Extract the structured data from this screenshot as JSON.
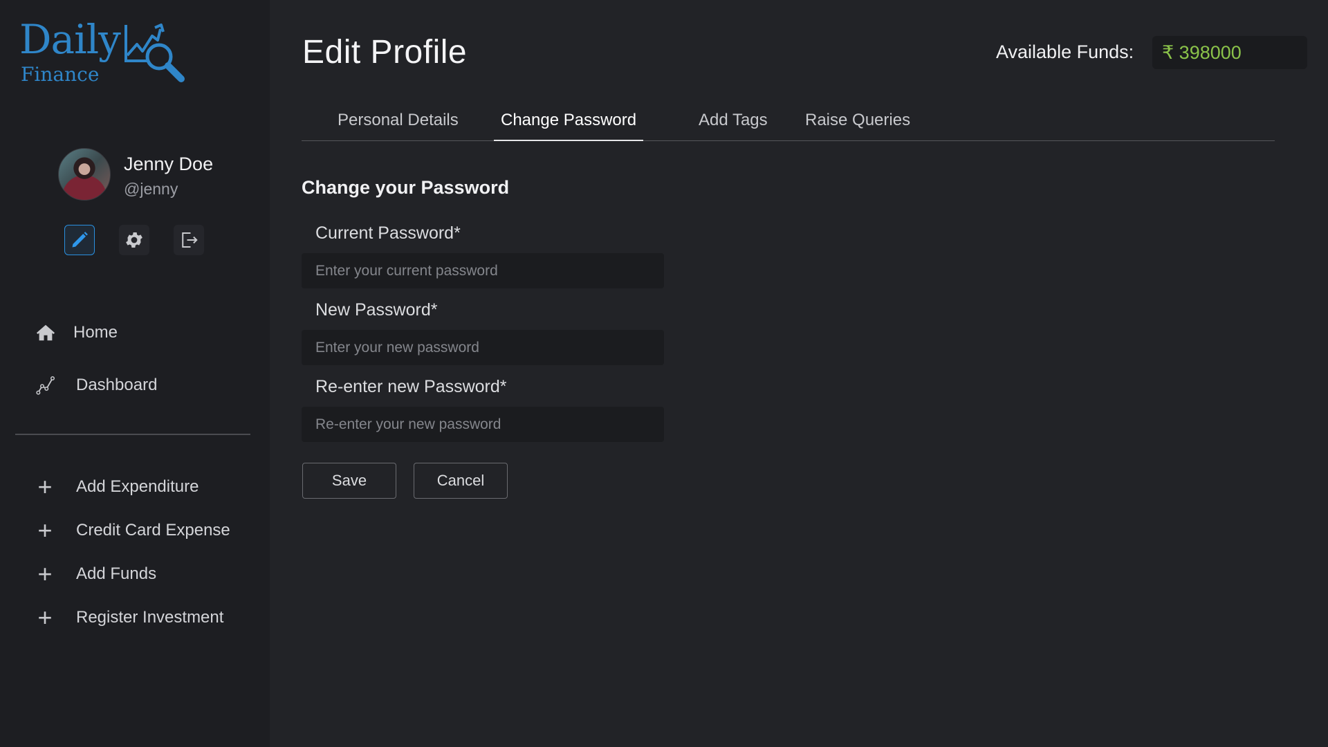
{
  "brand": {
    "name_top": "Daily",
    "name_bottom": "Finance",
    "color": "#2f86c9"
  },
  "user": {
    "name": "Jenny Doe",
    "handle": "@jenny"
  },
  "profile_actions": [
    {
      "name": "edit",
      "icon": "pencil-icon",
      "active": true
    },
    {
      "name": "settings",
      "icon": "gear-icon",
      "active": false
    },
    {
      "name": "logout",
      "icon": "logout-icon",
      "active": false
    }
  ],
  "sidebar": {
    "nav": [
      {
        "label": "Home",
        "icon": "home-icon"
      },
      {
        "label": "Dashboard",
        "icon": "chart-icon"
      }
    ],
    "actions": [
      {
        "label": "Add Expenditure",
        "icon": "plus-icon"
      },
      {
        "label": "Credit Card Expense",
        "icon": "plus-icon"
      },
      {
        "label": "Add Funds",
        "icon": "plus-icon"
      },
      {
        "label": "Register Investment",
        "icon": "plus-icon"
      }
    ]
  },
  "header": {
    "title": "Edit Profile",
    "funds_label": "Available Funds:",
    "funds_value": "₹ 398000",
    "funds_color": "#8bc34a"
  },
  "tabs": [
    {
      "label": "Personal Details",
      "active": false
    },
    {
      "label": "Change Password",
      "active": true
    },
    {
      "label": "Add Tags",
      "active": false
    },
    {
      "label": "Raise Queries",
      "active": false
    }
  ],
  "form": {
    "title": "Change your Password",
    "fields": [
      {
        "label": "Current Password*",
        "placeholder": "Enter your current password",
        "value": ""
      },
      {
        "label": "New Password*",
        "placeholder": "Enter your new password",
        "value": ""
      },
      {
        "label": "Re-enter new Password*",
        "placeholder": "Re-enter your new password",
        "value": ""
      }
    ],
    "save_label": "Save",
    "cancel_label": "Cancel"
  }
}
